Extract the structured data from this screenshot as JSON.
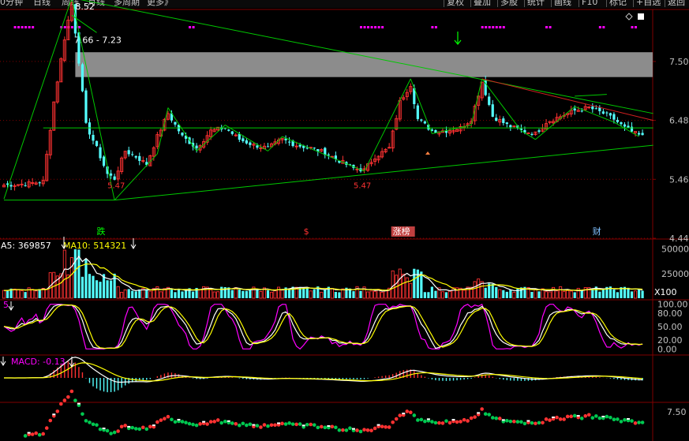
{
  "toolbar": {
    "left": [
      "0分钟",
      "日线",
      "周线",
      "月线",
      "多周期",
      "更多"
    ],
    "more_suffix": "》",
    "right": [
      "复权",
      "叠加",
      "多股",
      "统计",
      "画线",
      "F10",
      "标记",
      "+自选",
      "返回"
    ]
  },
  "colors": {
    "up": "#ff3232",
    "down": "#54ffff",
    "ma_white": "#ffffff",
    "ma_yellow": "#ffff00",
    "magenta": "#ff00ff",
    "green_line": "#00c800",
    "red_line": "#d02020",
    "grid": "#800000",
    "axis_text": "#c0c0c0"
  },
  "chart_data": [
    {
      "type": "candlestick",
      "ylim": [
        4.44,
        8.4
      ],
      "y_ticks": [
        "7.50",
        "6.48",
        "5.46",
        "4.44"
      ],
      "y_tick_values": [
        7.5,
        6.48,
        5.46,
        4.44
      ],
      "n_bars": 180,
      "annotations": {
        "high": "8.52",
        "zone": "7.66 - 7.23",
        "zone_range": [
          7.23,
          7.66
        ],
        "low1": "5.47",
        "low2": "5.47"
      },
      "markers": [
        "跌",
        "$",
        "涨榜",
        "财"
      ],
      "anchors": [
        [
          0,
          5.36
        ],
        [
          6,
          5.38
        ],
        [
          11,
          5.42
        ],
        [
          14,
          6.8
        ],
        [
          17,
          7.9
        ],
        [
          19,
          8.52
        ],
        [
          21,
          7.5
        ],
        [
          23,
          6.4
        ],
        [
          26,
          6.0
        ],
        [
          29,
          5.55
        ],
        [
          31,
          5.47
        ],
        [
          34,
          5.95
        ],
        [
          37,
          5.85
        ],
        [
          40,
          5.72
        ],
        [
          43,
          6.2
        ],
        [
          46,
          6.6
        ],
        [
          50,
          6.2
        ],
        [
          54,
          6.0
        ],
        [
          58,
          6.3
        ],
        [
          62,
          6.35
        ],
        [
          66,
          6.15
        ],
        [
          70,
          6.05
        ],
        [
          74,
          6.0
        ],
        [
          78,
          6.15
        ],
        [
          82,
          6.05
        ],
        [
          86,
          6.0
        ],
        [
          90,
          5.92
        ],
        [
          94,
          5.78
        ],
        [
          98,
          5.65
        ],
        [
          101,
          5.62
        ],
        [
          104,
          5.85
        ],
        [
          108,
          6.0
        ],
        [
          111,
          6.8
        ],
        [
          114,
          7.1
        ],
        [
          116,
          6.5
        ],
        [
          120,
          6.3
        ],
        [
          124,
          6.3
        ],
        [
          128,
          6.35
        ],
        [
          131,
          6.5
        ],
        [
          134,
          7.15
        ],
        [
          137,
          6.55
        ],
        [
          141,
          6.4
        ],
        [
          145,
          6.3
        ],
        [
          149,
          6.25
        ],
        [
          152,
          6.45
        ],
        [
          156,
          6.55
        ],
        [
          160,
          6.65
        ],
        [
          164,
          6.7
        ],
        [
          168,
          6.6
        ],
        [
          171,
          6.5
        ],
        [
          174,
          6.35
        ],
        [
          177,
          6.25
        ],
        [
          179,
          6.2
        ]
      ]
    },
    {
      "type": "bar",
      "labels": {
        "ma5": "A5: 369857",
        "ma10": "MA10: 514321"
      },
      "y_ticks": [
        "50000",
        "25000"
      ],
      "y_tick_values": [
        50000,
        25000
      ],
      "ylim": [
        0,
        60000
      ],
      "unit": "X100"
    },
    {
      "type": "line",
      "labels": {
        "prefix": "5"
      },
      "y_ticks": [
        "100.00",
        "80.00",
        "50.00",
        "20.00",
        "0.00"
      ],
      "y_tick_values": [
        100,
        80,
        50,
        20,
        0
      ],
      "ylim": [
        -10,
        110
      ]
    },
    {
      "type": "bar",
      "labels": {
        "macd": "MACD: -0.13"
      },
      "ylim": [
        -0.8,
        0.8
      ]
    },
    {
      "type": "scatter",
      "y_ticks": [
        "7.50"
      ],
      "y_tick_values": [
        7.5
      ],
      "ylim": [
        5.5,
        8.2
      ]
    }
  ]
}
